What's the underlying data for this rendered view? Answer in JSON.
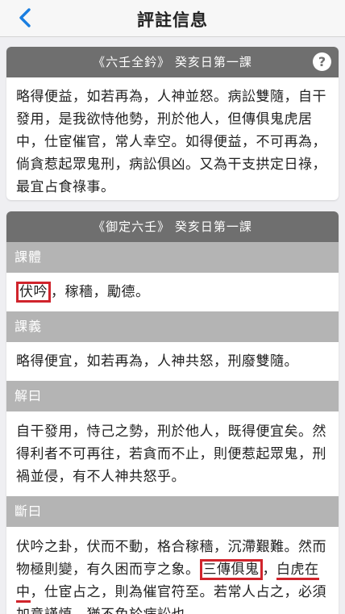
{
  "navbar": {
    "title": "評註信息",
    "back_icon": "chevron-left-icon"
  },
  "card1": {
    "header": "《六壬全鈐》 癸亥日第一課",
    "help_label": "?",
    "text": "略得便益，如若再為，人神並怒。病訟雙隨，自干發用，是我欲恃他勢，刑於他人，但傳俱鬼虎居中，仕宦催官，常人幸空。如得便益，不可再為，倘貪惹起眾鬼刑，病訟俱凶。又為干支拱定日祿，最宜占食祿事。"
  },
  "card2": {
    "header": "《御定六壬》 癸亥日第一課",
    "sections": [
      {
        "title": "課體",
        "highlight": "伏吟",
        "rest": "，稼穡，勵德。"
      },
      {
        "title": "課義",
        "text": "略得便宜，如若再為，人神共怒，刑廢雙隨。"
      },
      {
        "title": "解曰",
        "text": "自干發用，恃己之勢，刑於他人，既得便宜矣。然得利者不可再往，若貪而不止，則便惹起眾鬼，刑禍並侵，有不人神共怒乎。"
      },
      {
        "title": "斷曰",
        "part1": "伏吟之卦，伏而不動，格合稼穡，沉滯艱難。然而物極則變，有久困而亨之象。",
        "boxed": "三傳俱鬼",
        "part2": "，",
        "underlined_a": "白虎在",
        "underlined_b": "中",
        "part3": "，仕宦占之，則為催官符至。若常人占之，必須加意謹慎，猶不免於病訟也。"
      }
    ]
  },
  "colors": {
    "accent": "#1a7ee0",
    "header_dark": "#6f6f6f",
    "header_light": "#b4b4b4",
    "highlight_red": "#d0242c",
    "background": "#efeff2"
  }
}
